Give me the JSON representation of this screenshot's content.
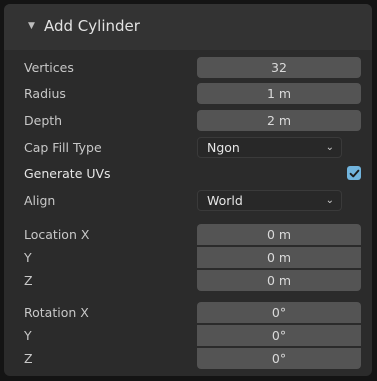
{
  "panel": {
    "title": "Add Cylinder",
    "collapse_glyph": "▼"
  },
  "fields": {
    "vertices": {
      "label": "Vertices",
      "value": "32"
    },
    "radius": {
      "label": "Radius",
      "value": "1 m"
    },
    "depth": {
      "label": "Depth",
      "value": "2 m"
    },
    "cap_fill_type": {
      "label": "Cap Fill Type",
      "value": "Ngon",
      "chevron": "⌄"
    },
    "generate_uvs": {
      "label": "Generate UVs",
      "checked": true,
      "icon": "checkmark-icon"
    },
    "align": {
      "label": "Align",
      "value": "World",
      "chevron": "⌄"
    },
    "location": {
      "x": {
        "label": "Location X",
        "value": "0 m"
      },
      "y": {
        "label": "Y",
        "value": "0 m"
      },
      "z": {
        "label": "Z",
        "value": "0 m"
      }
    },
    "rotation": {
      "x": {
        "label": "Rotation X",
        "value": "0°"
      },
      "y": {
        "label": "Y",
        "value": "0°"
      },
      "z": {
        "label": "Z",
        "value": "0°"
      }
    }
  },
  "colors": {
    "panel_bg": "#2b2b2b",
    "field_bg": "#545454",
    "select_bg": "#282828",
    "checkbox_accent": "#71b4dd"
  }
}
